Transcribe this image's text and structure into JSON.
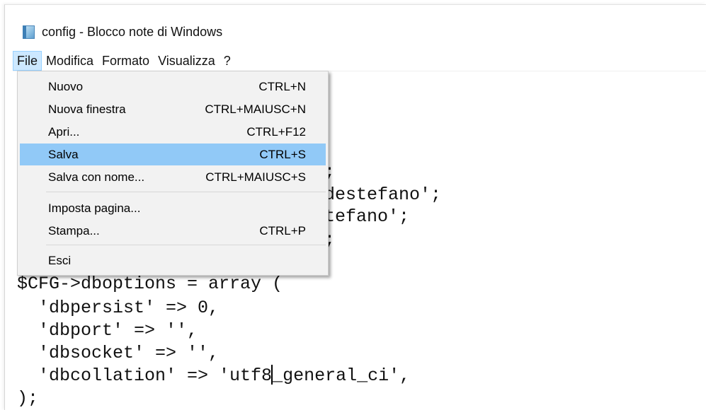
{
  "window": {
    "title": "config - Blocco note di Windows",
    "icon": "notepad-icon"
  },
  "menubar": {
    "items": [
      {
        "label": "File",
        "active": true
      },
      {
        "label": "Modifica"
      },
      {
        "label": "Formato"
      },
      {
        "label": "Visualizza"
      },
      {
        "label": "?"
      }
    ]
  },
  "file_menu": {
    "items": [
      {
        "label": "Nuovo",
        "shortcut": "CTRL+N"
      },
      {
        "label": "Nuova finestra",
        "shortcut": "CTRL+MAIUSC+N"
      },
      {
        "label": "Apri...",
        "shortcut": "CTRL+F12"
      },
      {
        "label": "Salva",
        "shortcut": "CTRL+S",
        "highlighted": true
      },
      {
        "label": "Salva con nome...",
        "shortcut": "CTRL+MAIUSC+S"
      },
      {
        "label": "Imposta pagina...",
        "shortcut": ""
      },
      {
        "label": "Stampa...",
        "shortcut": "CTRL+P"
      },
      {
        "label": "Esci",
        "shortcut": ""
      }
    ]
  },
  "editor": {
    "partial_lines": [
      ";",
      "destefano';",
      "tefano';",
      ";"
    ],
    "lines": [
      "$CFG->dboptions = array (",
      "  'dbpersist' => 0,",
      "  'dbport' => '',",
      "  'dbsocket' => '',",
      "  'dbcollation' => 'utf8_general_ci',",
      ");"
    ],
    "caret_line_before": "  'dbcollation' => 'utf8",
    "caret_line_after": "_general_ci',"
  },
  "colors": {
    "menu_highlight": "#91c9f7",
    "menubar_active_bg": "#cce8ff",
    "menu_bg": "#f2f2f2"
  }
}
